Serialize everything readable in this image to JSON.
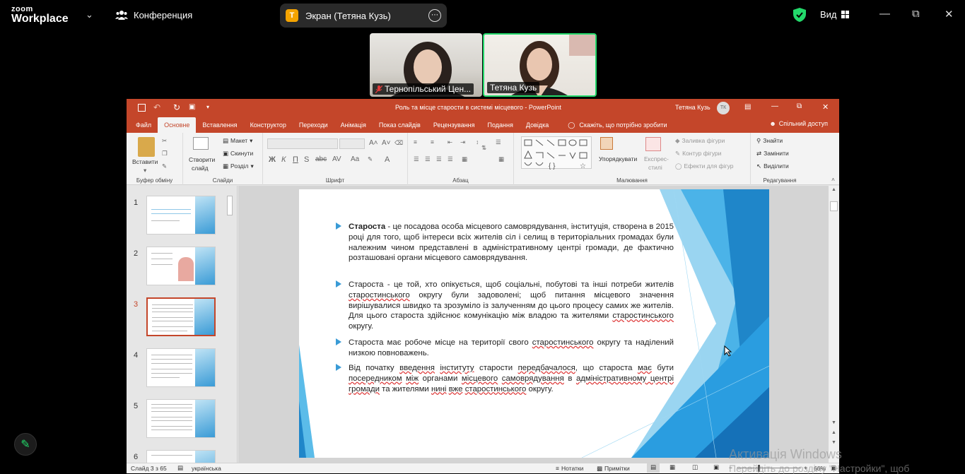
{
  "zoom": {
    "logo_top": "zoom",
    "logo_bottom": "Workplace",
    "meeting_label": "Конференция",
    "screen_badge": "Т",
    "screen_label": "Экран (Тетяна Кузь)",
    "view_label": "Вид"
  },
  "participants": [
    {
      "name": "Тернопільський Цен...",
      "muted": true
    },
    {
      "name": "Тетяна Кузь",
      "muted": false
    }
  ],
  "ppt": {
    "title": "Роль та місце старости в системі місцевого  -  PowerPoint",
    "user": "Тетяна Кузь",
    "user_initials": "ТК",
    "tabs": [
      "Файл",
      "Основне",
      "Вставлення",
      "Конструктор",
      "Переходи",
      "Анімація",
      "Показ слайдів",
      "Рецензування",
      "Подання",
      "Довідка"
    ],
    "tell_me": "Скажіть, що потрібно зробити",
    "share": "Спільний доступ",
    "ribbon": {
      "clipboard": {
        "paste": "Вставити",
        "name": "Буфер обміну"
      },
      "slides": {
        "new_slide_1": "Створити",
        "new_slide_2": "слайд",
        "layout": "Макет",
        "reset": "Скинути",
        "section": "Розділ",
        "name": "Слайди"
      },
      "font": {
        "name": "Шрифт"
      },
      "paragraph": {
        "name": "Абзац"
      },
      "drawing": {
        "arrange": "Упорядкувати",
        "quick_styles_1": "Експрес-",
        "quick_styles_2": "стилі",
        "fill": "Заливка фігури",
        "outline": "Контур фігури",
        "effects": "Ефекти для фігур",
        "name": "Малювання"
      },
      "editing": {
        "find": "Знайти",
        "replace": "Замінити",
        "select": "Виділити",
        "name": "Редагування"
      }
    },
    "thumbnails": [
      "1",
      "2",
      "3",
      "4",
      "5",
      "6"
    ],
    "selected_slide": 3,
    "status": {
      "slide_info": "Слайд 3 з 65",
      "language": "українська",
      "notes": "Нотатки",
      "comments": "Примітки",
      "zoom": "66%"
    }
  },
  "slide": {
    "b1_bold": "Староста",
    "b1_rest": " - це посадова особа місцевого самоврядування, інституція, створена в 2015 році для того, щоб інтереси всіх жителів сіл і селищ в територіальних громадах були належним чином представлені в адміністративному центрі громади, де фактично розташовані органи місцевого самоврядування.",
    "b2_a": "Староста - це той, хто опікується, щоб соціальні, побутові та інші потреби жителів ",
    "b2_u1": "старостинського",
    "b2_b": " округу були задоволені; щоб питання місцевого значення вирішувалися швидко та зрозуміло із залученням до цього процесу самих же жителів. Для цього староста здійснює комунікацію між владою та жителями ",
    "b2_u2": "старостинського",
    "b2_c": " округу.",
    "b3_a": " Староста має робоче місце на території свого ",
    "b3_u": "старостинського",
    "b3_b": " округу та наділений низкою повноважень.",
    "b4_a": "Від початку ",
    "b4_u1": "введення",
    "b4_s1": " ",
    "b4_u2": "інституту",
    "b4_b": " старости ",
    "b4_u3": "передбачалося",
    "b4_c": ", що староста ",
    "b4_u4": "має",
    "b4_d": " бути ",
    "b4_u5": "посередником",
    "b4_s2": " ",
    "b4_u6": "між",
    "b4_e": " органами ",
    "b4_u7": "місцевого",
    "b4_s3": " ",
    "b4_u8": "самоврядування",
    "b4_f": " в ",
    "b4_u9": "адміністративному центрі громади",
    "b4_g": " та жителями ",
    "b4_u10": "нині",
    "b4_s4": " ",
    "b4_u11": "вже",
    "b4_s5": " ",
    "b4_u12": "старостинського",
    "b4_h": " округу."
  },
  "windows_watermark": {
    "line1": "Активація Windows",
    "line2": "Перейдіть до розділу \"Настройки\", щоб"
  }
}
